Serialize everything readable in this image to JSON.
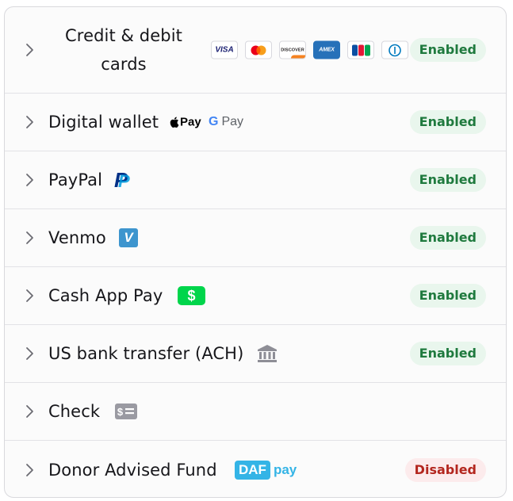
{
  "methods": [
    {
      "title": "Credit & debit cards",
      "status": "Enabled",
      "cards": [
        {
          "icon": "visa-icon",
          "label": "VISA"
        },
        {
          "icon": "mastercard-icon"
        },
        {
          "icon": "discover-icon",
          "label": "DISCOVER"
        },
        {
          "icon": "amex-icon",
          "label": "AMEX"
        },
        {
          "icon": "jcb-icon",
          "label": "JCB"
        },
        {
          "icon": "diners-club-icon"
        }
      ]
    },
    {
      "title": "Digital wallet",
      "status": "Enabled",
      "apple_pay_label": "Pay",
      "google_pay_g": "G",
      "google_pay_label": "Pay"
    },
    {
      "title": "PayPal",
      "status": "Enabled",
      "icon_letter": "P"
    },
    {
      "title": "Venmo",
      "status": "Enabled",
      "icon_letter": "V"
    },
    {
      "title": "Cash App Pay",
      "status": "Enabled",
      "icon_symbol": "$"
    },
    {
      "title": "US bank transfer (ACH)",
      "status": "Enabled",
      "icon": "bank-icon"
    },
    {
      "title": "Check",
      "status": "",
      "icon": "check-icon"
    },
    {
      "title": "Donor Advised Fund",
      "status": "Disabled",
      "daf_label": "DAF",
      "daf_pay_label": "pay"
    }
  ],
  "colors": {
    "enabled_bg": "#e9f6ed",
    "enabled_text": "#1f7a3e",
    "disabled_bg": "#fcebec",
    "disabled_text": "#b3261e",
    "paypal_dark": "#003087",
    "paypal_light": "#009cde",
    "venmo": "#3d95ce",
    "cashapp": "#00d54b",
    "daf": "#34b4e6"
  }
}
